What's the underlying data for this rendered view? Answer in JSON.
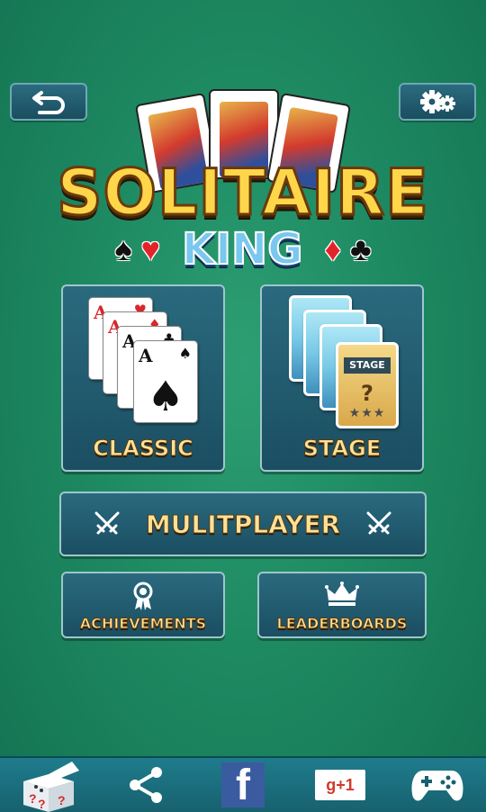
{
  "header": {
    "back_icon": "back-arrow-icon",
    "settings_icon": "gear-icon"
  },
  "logo": {
    "title": "SOLITAIRE",
    "subtitle": "KING",
    "left_suits": [
      "♠",
      "♥"
    ],
    "right_suits": [
      "♦",
      "♣"
    ]
  },
  "menu": {
    "classic_label": "CLASSIC",
    "stage_label": "STAGE",
    "multiplayer_label": "MULITPLAYER",
    "achievements_label": "ACHIEVEMENTS",
    "leaderboards_label": "LEADERBOARDS"
  },
  "classic_cards": [
    {
      "rank": "A",
      "suit": "♥",
      "color": "#d8262c"
    },
    {
      "rank": "A",
      "suit": "♦",
      "color": "#d8262c"
    },
    {
      "rank": "A",
      "suit": "♣",
      "color": "#111111"
    },
    {
      "rank": "A",
      "suit": "♠",
      "color": "#111111"
    }
  ],
  "stage_card": {
    "tag": "STAGE",
    "mark": "?",
    "stars": "★★★"
  },
  "bottom_bar": {
    "gift_icon": "gift-box-icon",
    "share_icon": "share-icon",
    "facebook_icon": "facebook-icon",
    "facebook_label": "f",
    "gplus_icon": "google-plus-icon",
    "gplus_label": "g+1",
    "gamepad_icon": "gamepad-icon"
  },
  "colors": {
    "background": "#1e8a62",
    "panel": "#1b4e62",
    "label_gold": "#ffe19a",
    "title_gold": "#ffd64a",
    "subtitle_blue": "#7ac7ef"
  }
}
